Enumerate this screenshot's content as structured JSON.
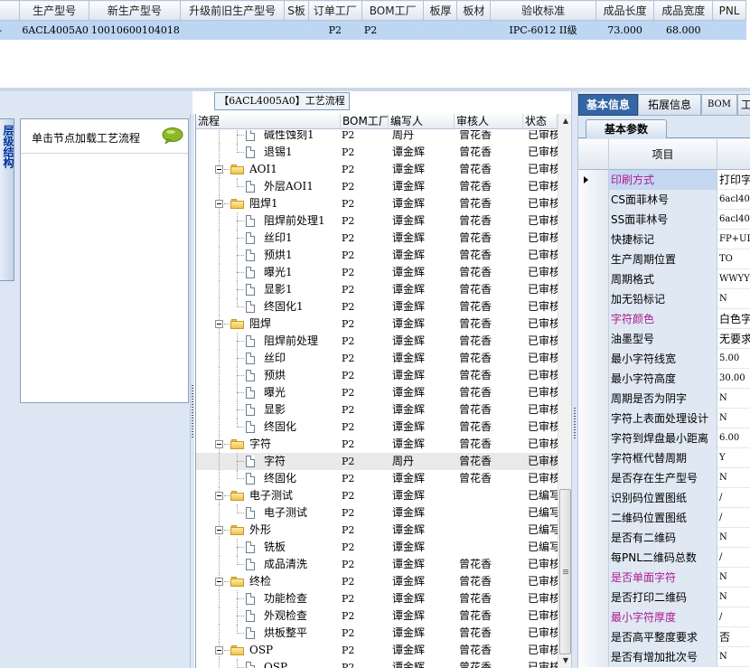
{
  "top_grid": {
    "columns": [
      "",
      "生产型号",
      "新生产型号",
      "升级前旧生产型号",
      "S板",
      "订单工厂",
      "BOM工厂",
      "板厚",
      "板材",
      "验收标准",
      "成品长度",
      "成品宽度",
      "PNL"
    ],
    "row": [
      "-",
      "6ACL4005A0",
      "10010600104018",
      "",
      "",
      "P2",
      "P2",
      "",
      "",
      "IPC-6012 II级",
      "73.000",
      "68.000",
      ""
    ]
  },
  "left_panel": {
    "vertical_tab": "层级结构",
    "hint": "单击节点加载工艺流程",
    "hint_icon": "speech-bubble-icon"
  },
  "center_panel": {
    "title": "【6ACL4005A0】工艺流程",
    "columns": [
      "流程",
      "BOM工厂",
      "编写人",
      "审核人",
      "状态"
    ],
    "rows": [
      {
        "level": 2,
        "name": "碱性蚀刻1",
        "bom": "P2",
        "writer": "周丹",
        "reviewer": "曾花香",
        "status": "已审核"
      },
      {
        "level": 2,
        "name": "退锡1",
        "bom": "P2",
        "writer": "谭金辉",
        "reviewer": "曾花香",
        "status": "已审核"
      },
      {
        "level": 1,
        "name": "AOI1",
        "bom": "P2",
        "writer": "谭金辉",
        "reviewer": "曾花香",
        "status": "已审核"
      },
      {
        "level": 2,
        "name": "外层AOI1",
        "bom": "P2",
        "writer": "谭金辉",
        "reviewer": "曾花香",
        "status": "已审核"
      },
      {
        "level": 1,
        "name": "阻焊1",
        "bom": "P2",
        "writer": "谭金辉",
        "reviewer": "曾花香",
        "status": "已审核"
      },
      {
        "level": 2,
        "name": "阻焊前处理1",
        "bom": "P2",
        "writer": "谭金辉",
        "reviewer": "曾花香",
        "status": "已审核"
      },
      {
        "level": 2,
        "name": "丝印1",
        "bom": "P2",
        "writer": "谭金辉",
        "reviewer": "曾花香",
        "status": "已审核"
      },
      {
        "level": 2,
        "name": "预烘1",
        "bom": "P2",
        "writer": "谭金辉",
        "reviewer": "曾花香",
        "status": "已审核"
      },
      {
        "level": 2,
        "name": "曝光1",
        "bom": "P2",
        "writer": "谭金辉",
        "reviewer": "曾花香",
        "status": "已审核"
      },
      {
        "level": 2,
        "name": "显影1",
        "bom": "P2",
        "writer": "谭金辉",
        "reviewer": "曾花香",
        "status": "已审核"
      },
      {
        "level": 2,
        "name": "终固化1",
        "bom": "P2",
        "writer": "谭金辉",
        "reviewer": "曾花香",
        "status": "已审核"
      },
      {
        "level": 1,
        "name": "阻焊",
        "bom": "P2",
        "writer": "谭金辉",
        "reviewer": "曾花香",
        "status": "已审核"
      },
      {
        "level": 2,
        "name": "阻焊前处理",
        "bom": "P2",
        "writer": "谭金辉",
        "reviewer": "曾花香",
        "status": "已审核"
      },
      {
        "level": 2,
        "name": "丝印",
        "bom": "P2",
        "writer": "谭金辉",
        "reviewer": "曾花香",
        "status": "已审核"
      },
      {
        "level": 2,
        "name": "预烘",
        "bom": "P2",
        "writer": "谭金辉",
        "reviewer": "曾花香",
        "status": "已审核"
      },
      {
        "level": 2,
        "name": "曝光",
        "bom": "P2",
        "writer": "谭金辉",
        "reviewer": "曾花香",
        "status": "已审核"
      },
      {
        "level": 2,
        "name": "显影",
        "bom": "P2",
        "writer": "谭金辉",
        "reviewer": "曾花香",
        "status": "已审核"
      },
      {
        "level": 2,
        "name": "终固化",
        "bom": "P2",
        "writer": "谭金辉",
        "reviewer": "曾花香",
        "status": "已审核"
      },
      {
        "level": 1,
        "name": "字符",
        "bom": "P2",
        "writer": "谭金辉",
        "reviewer": "曾花香",
        "status": "已审核"
      },
      {
        "level": 2,
        "name": "字符",
        "bom": "P2",
        "writer": "周丹",
        "reviewer": "曾花香",
        "status": "已审核",
        "selected": true
      },
      {
        "level": 2,
        "name": "终固化",
        "bom": "P2",
        "writer": "谭金辉",
        "reviewer": "曾花香",
        "status": "已审核"
      },
      {
        "level": 1,
        "name": "电子测试",
        "bom": "P2",
        "writer": "谭金辉",
        "reviewer": "",
        "status": "已编写"
      },
      {
        "level": 2,
        "name": "电子测试",
        "bom": "P2",
        "writer": "谭金辉",
        "reviewer": "",
        "status": "已编写"
      },
      {
        "level": 1,
        "name": "外形",
        "bom": "P2",
        "writer": "谭金辉",
        "reviewer": "",
        "status": "已编写"
      },
      {
        "level": 2,
        "name": "铣板",
        "bom": "P2",
        "writer": "谭金辉",
        "reviewer": "",
        "status": "已编写"
      },
      {
        "level": 2,
        "name": "成品清洗",
        "bom": "P2",
        "writer": "谭金辉",
        "reviewer": "曾花香",
        "status": "已审核"
      },
      {
        "level": 1,
        "name": "终检",
        "bom": "P2",
        "writer": "谭金辉",
        "reviewer": "曾花香",
        "status": "已审核"
      },
      {
        "level": 2,
        "name": "功能检查",
        "bom": "P2",
        "writer": "谭金辉",
        "reviewer": "曾花香",
        "status": "已审核"
      },
      {
        "level": 2,
        "name": "外观检查",
        "bom": "P2",
        "writer": "谭金辉",
        "reviewer": "曾花香",
        "status": "已审核"
      },
      {
        "level": 2,
        "name": "烘板整平",
        "bom": "P2",
        "writer": "谭金辉",
        "reviewer": "曾花香",
        "status": "已审核"
      },
      {
        "level": 1,
        "name": "OSP",
        "bom": "P2",
        "writer": "谭金辉",
        "reviewer": "曾花香",
        "status": "已审核"
      },
      {
        "level": 2,
        "name": "OSP",
        "bom": "P2",
        "writer": "谭金辉",
        "reviewer": "曾花香",
        "status": "已审核"
      }
    ]
  },
  "right_panel": {
    "tabs": [
      "基本信息",
      "拓展信息",
      "BOM",
      "工"
    ],
    "subtab": "基本参数",
    "grid_header": "项目",
    "rows": [
      {
        "key": "印刷方式",
        "value": "打印字",
        "magenta": true,
        "current": true
      },
      {
        "key": "CS面菲林号",
        "value": "6acl40"
      },
      {
        "key": "SS面菲林号",
        "value": "6acl40"
      },
      {
        "key": "快捷标记",
        "value": "FP+UL+"
      },
      {
        "key": "生产周期位置",
        "value": "TO"
      },
      {
        "key": "周期格式",
        "value": "WWYY"
      },
      {
        "key": "加无铅标记",
        "value": "N"
      },
      {
        "key": "字符颜色",
        "value": "白色字",
        "magenta": true
      },
      {
        "key": "油墨型号",
        "value": "无要求"
      },
      {
        "key": "最小字符线宽",
        "value": "5.00"
      },
      {
        "key": "最小字符高度",
        "value": "30.00"
      },
      {
        "key": "周期是否为阴字",
        "value": "N"
      },
      {
        "key": "字符上表面处理设计",
        "value": "N"
      },
      {
        "key": "字符到焊盘最小距离",
        "value": "6.00"
      },
      {
        "key": "字符框代替周期",
        "value": "Y"
      },
      {
        "key": "是否存在生产型号",
        "value": "N"
      },
      {
        "key": "识别码位置图纸",
        "value": "/"
      },
      {
        "key": "二维码位置图纸",
        "value": "/"
      },
      {
        "key": "是否有二维码",
        "value": "N"
      },
      {
        "key": "每PNL二维码总数",
        "value": "/"
      },
      {
        "key": "是否单面字符",
        "value": "N",
        "magenta": true
      },
      {
        "key": "是否打印二维码",
        "value": "N"
      },
      {
        "key": "最小字符厚度",
        "value": "/",
        "magenta": true
      },
      {
        "key": "是否高平整度要求",
        "value": "否"
      },
      {
        "key": "是否有增加批次号",
        "value": "N"
      }
    ]
  }
}
